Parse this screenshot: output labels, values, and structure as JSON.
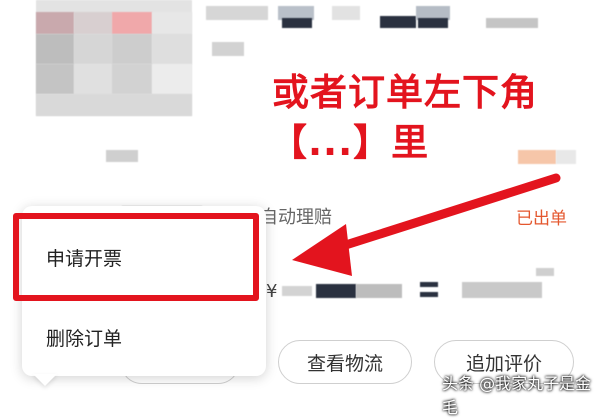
{
  "annotation": {
    "line1": "或者订单左下角",
    "line2": "【...】里",
    "color": "#e3141e"
  },
  "order": {
    "guarantee_text": "退货可自动理赔",
    "status": "已出单",
    "price_symbol": "¥"
  },
  "popup_menu": {
    "items": [
      {
        "label": "申请开票"
      },
      {
        "label": "删除订单"
      }
    ]
  },
  "actions": {
    "logistics_label": "查看物流",
    "review_label": "追加评价"
  },
  "watermark": "头条 @我家丸子是金毛"
}
